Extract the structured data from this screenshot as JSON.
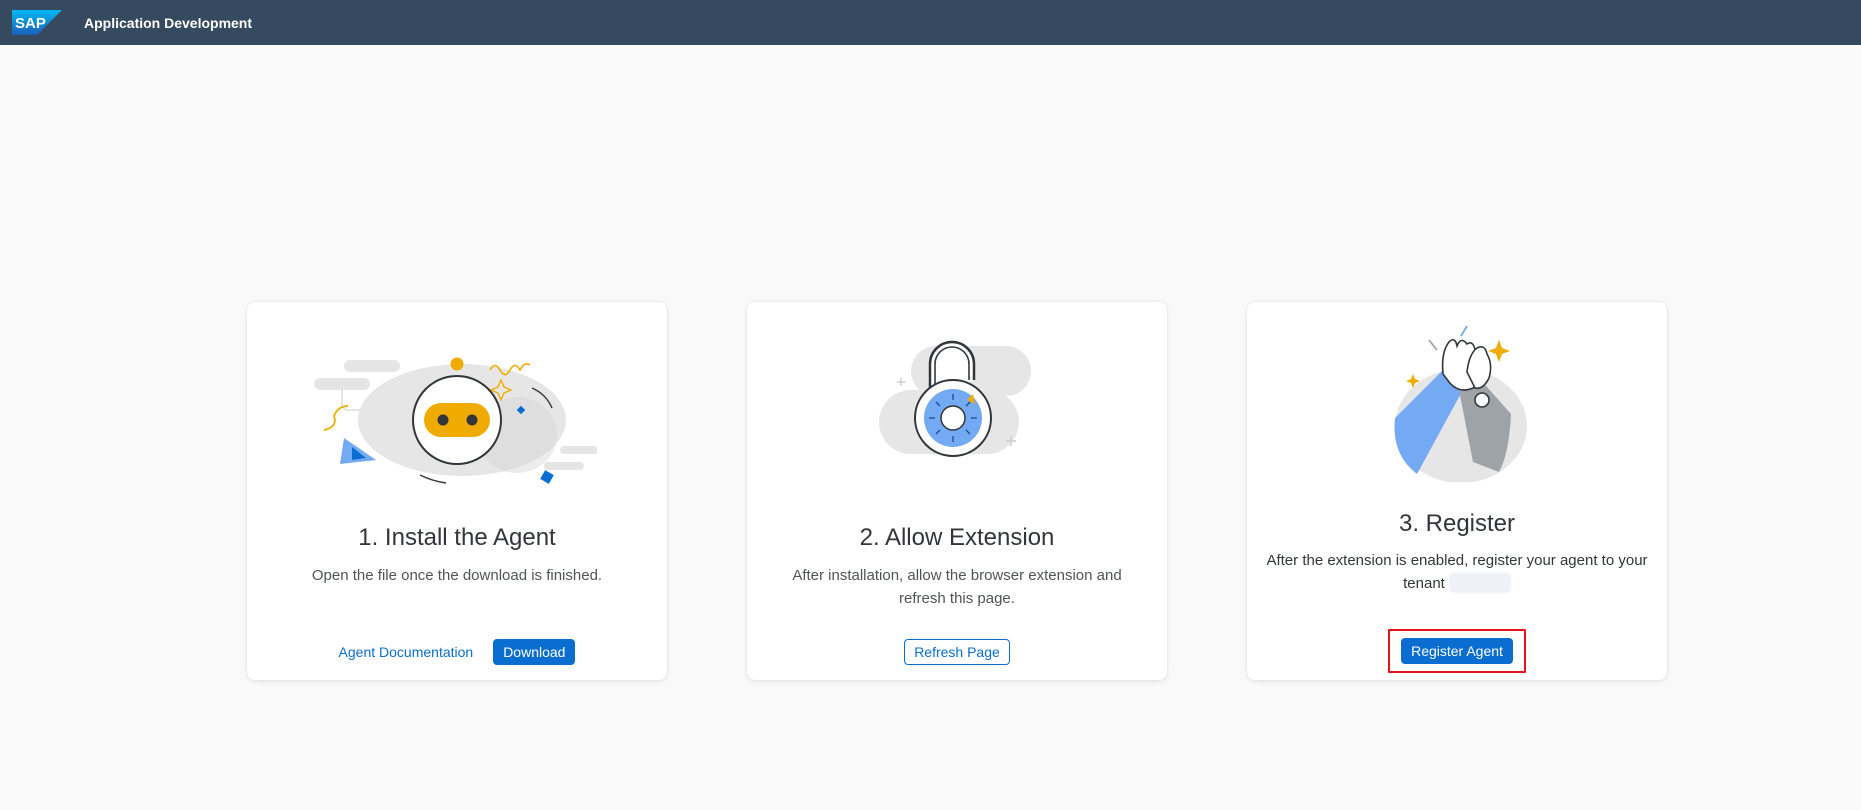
{
  "shell": {
    "logo_text": "SAP",
    "app_title": "Application Development"
  },
  "steps": [
    {
      "title": "1. Install the Agent",
      "description": "Open the file once the download is finished.",
      "link_label": "Agent Documentation",
      "button_label": "Download"
    },
    {
      "title": "2. Allow Extension",
      "description": "After installation, allow the browser extension and refresh this page.",
      "button_label": "Refresh Page"
    },
    {
      "title": "3. Register",
      "description": "After the extension is enabled, register your agent to your tenant",
      "button_label": "Register Agent"
    }
  ],
  "colors": {
    "shellbar": "#354a5f",
    "accent": "#0a6ed1",
    "highlight": "#e3141b",
    "background": "#f9f9f9"
  },
  "icons": [
    "sap-logo",
    "robot-illustration",
    "padlock-illustration",
    "high-five-illustration"
  ]
}
